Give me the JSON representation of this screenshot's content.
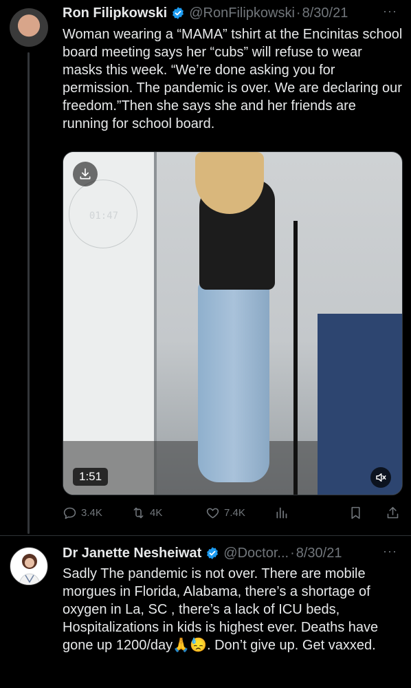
{
  "tweets": [
    {
      "author_name": "Ron Filipkowski",
      "handle": "@RonFilipkowski",
      "separator": "·",
      "date": "8/30/21",
      "more": "···",
      "text": "Woman wearing a “MAMA” tshirt at the Encinitas school board meeting says her “cubs” will refuse to wear masks this week. “We’re done asking you for permission. The pandemic is over. We are declaring our freedom.”Then she says she and her friends are running for school board.",
      "media": {
        "duration": "1:51",
        "clock_text": "01:47"
      },
      "actions": {
        "replies": "3.4K",
        "retweets": "4K",
        "likes": "7.4K"
      }
    },
    {
      "author_name": "Dr Janette Nesheiwat",
      "handle": "@Doctor...",
      "separator": "·",
      "date": "8/30/21",
      "more": "···",
      "text": "Sadly The pandemic is not over. There are mobile morgues in Florida, Alabama,   there’s a shortage of oxygen in La, SC , there’s a lack of ICU beds, Hospitalizations in kids is highest ever. Deaths have gone up 1200/day🙏😓. Don’t give up. Get vaxxed."
    }
  ],
  "colors": {
    "background": "#000000",
    "text": "#e7e9ea",
    "muted": "#71767b",
    "verified": "#1d9bf0"
  }
}
